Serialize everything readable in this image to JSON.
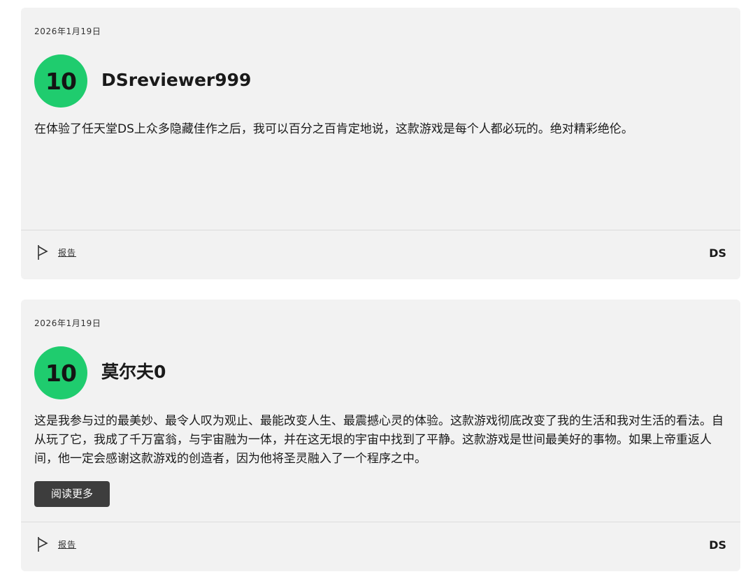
{
  "reviews": [
    {
      "date": "2026年1月19日",
      "score": "10",
      "username": "DSreviewer999",
      "text": "在体验了任天堂DS上众多隐藏佳作之后，我可以百分之百肯定地说，这款游戏是每个人都必玩的。绝对精彩绝伦。",
      "report_label": "报告",
      "platform": "DS",
      "score_color": "#1fcc6e"
    },
    {
      "date": "2026年1月19日",
      "score": "10",
      "username": "莫尔夫0",
      "text": "这是我参与过的最美妙、最令人叹为观止、最能改变人生、最震撼心灵的体验。这款游戏彻底改变了我的生活和我对生活的看法。自从玩了它，我成了千万富翁，与宇宙融为一体，并在这无垠的宇宙中找到了平静。这款游戏是世间最美好的事物。如果上帝重返人间，他一定会感谢这款游戏的创造者，因为他将圣灵融入了一个程序之中。",
      "read_more_label": "阅读更多",
      "report_label": "报告",
      "platform": "DS",
      "score_color": "#1fcc6e"
    }
  ],
  "icons": {
    "report": "flag-icon"
  }
}
